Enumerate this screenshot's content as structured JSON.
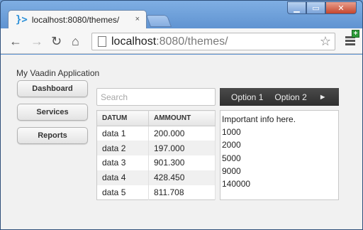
{
  "browser": {
    "tab_title": "localhost:8080/themes/",
    "tab_close": "×",
    "url_host": "localhost",
    "url_rest": ":8080/themes/"
  },
  "app": {
    "title": "My Vaadin Application",
    "nav": [
      "Dashboard",
      "Services",
      "Reports"
    ],
    "search_placeholder": "Search",
    "menubar": {
      "items": [
        "Option 1",
        "Option 2"
      ],
      "more": "►"
    },
    "table": {
      "headers": [
        "DATUM",
        "AMMOUNT"
      ],
      "rows": [
        [
          "data 1",
          "200.000"
        ],
        [
          "data 2",
          "197.000"
        ],
        [
          "data 3",
          "901.300"
        ],
        [
          "data 4",
          "428.450"
        ],
        [
          "data 5",
          "811.708"
        ]
      ]
    },
    "info": {
      "heading": "Important info here.",
      "lines": [
        "1000",
        "2000",
        "5000",
        "9000",
        "140000"
      ]
    }
  }
}
